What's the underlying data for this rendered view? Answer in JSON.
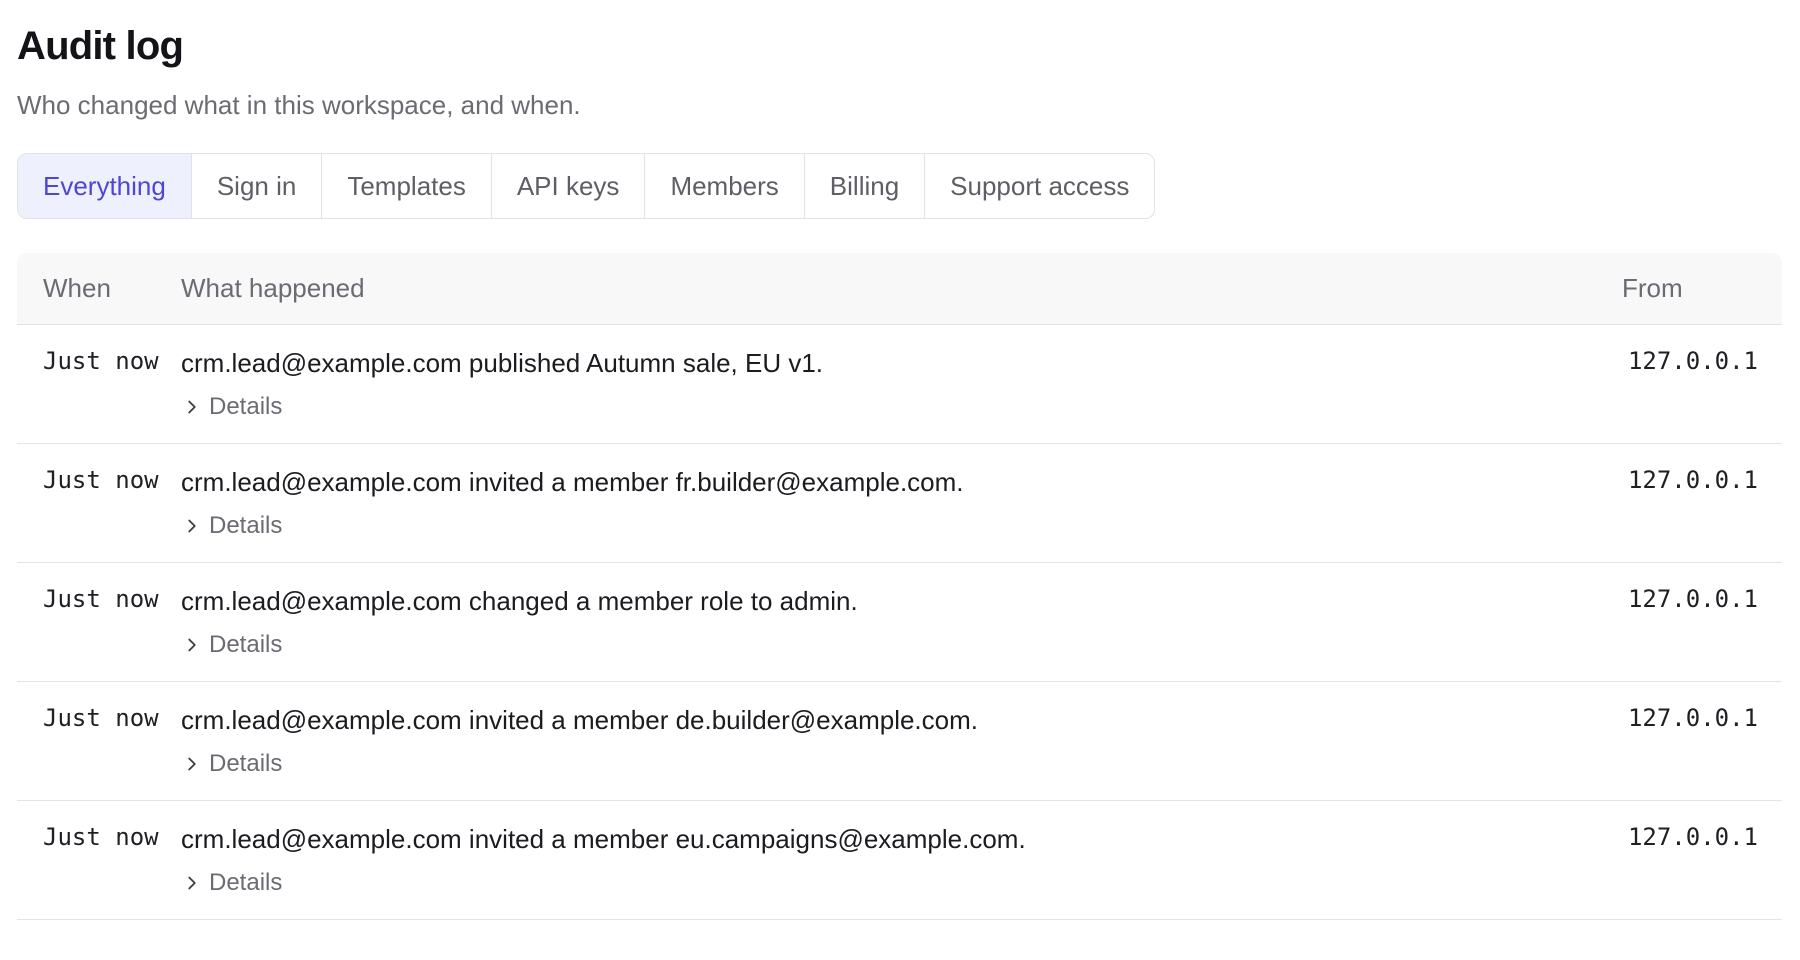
{
  "header": {
    "title": "Audit log",
    "subtitle": "Who changed what in this workspace, and when."
  },
  "tabs": [
    {
      "label": "Everything",
      "active": true
    },
    {
      "label": "Sign in",
      "active": false
    },
    {
      "label": "Templates",
      "active": false
    },
    {
      "label": "API keys",
      "active": false
    },
    {
      "label": "Members",
      "active": false
    },
    {
      "label": "Billing",
      "active": false
    },
    {
      "label": "Support access",
      "active": false
    }
  ],
  "table": {
    "columns": {
      "when": "When",
      "what": "What happened",
      "from": "From"
    },
    "details_label": "Details",
    "rows": [
      {
        "when": "Just now",
        "what": "crm.lead@example.com published Autumn sale, EU v1.",
        "from": "127.0.0.1"
      },
      {
        "when": "Just now",
        "what": "crm.lead@example.com invited a member fr.builder@example.com.",
        "from": "127.0.0.1"
      },
      {
        "when": "Just now",
        "what": "crm.lead@example.com changed a member role to admin.",
        "from": "127.0.0.1"
      },
      {
        "when": "Just now",
        "what": "crm.lead@example.com invited a member de.builder@example.com.",
        "from": "127.0.0.1"
      },
      {
        "when": "Just now",
        "what": "crm.lead@example.com invited a member eu.campaigns@example.com.",
        "from": "127.0.0.1"
      }
    ]
  },
  "colors": {
    "accent": "#4f46d1",
    "active_tab_bg": "#eef0fd",
    "muted_text": "#6b6b73",
    "border": "#e2e2e6"
  },
  "icons": {
    "details_toggle": "chevron-right-icon"
  }
}
